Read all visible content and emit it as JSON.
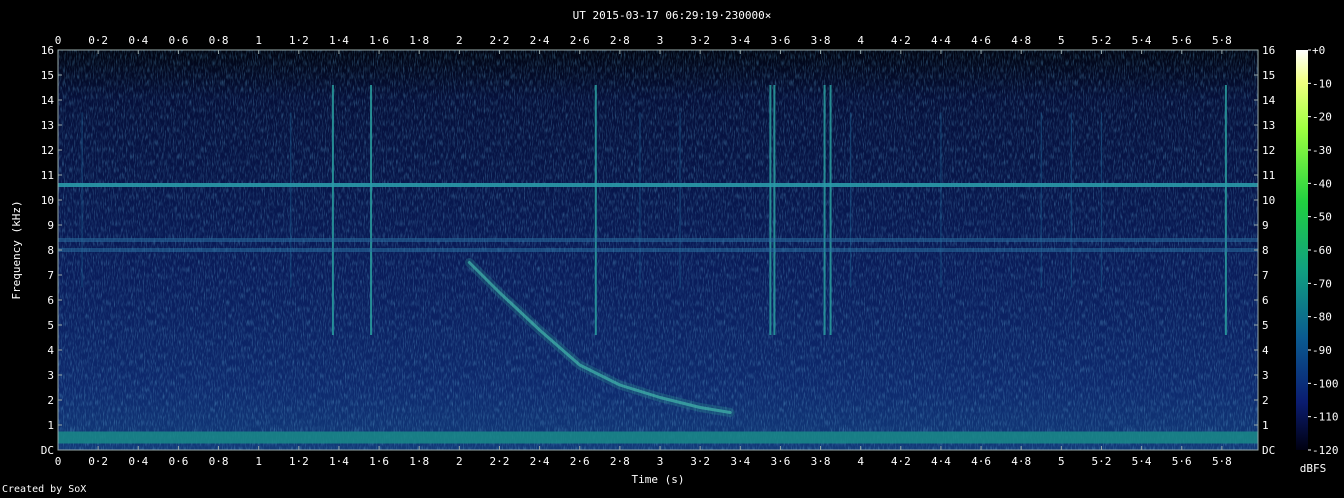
{
  "chart_data": {
    "type": "heatmap",
    "title": "UT 2015-03-17 06:29:19·230000×",
    "xlabel": "Time (s)",
    "ylabel": "Frequency (kHz)",
    "xlim": [
      0,
      5.98
    ],
    "ylim": [
      0,
      16
    ],
    "x_ticks": [
      "0",
      "0·2",
      "0·4",
      "0·6",
      "0·8",
      "1",
      "1·2",
      "1·4",
      "1·6",
      "1·8",
      "2",
      "2·2",
      "2·4",
      "2·6",
      "2·8",
      "3",
      "3·2",
      "3·4",
      "3·6",
      "3·8",
      "4",
      "4·2",
      "4·4",
      "4·6",
      "4·8",
      "5",
      "5·2",
      "5·4",
      "5·6",
      "5·8"
    ],
    "y_ticks": [
      "DC",
      "1",
      "2",
      "3",
      "4",
      "5",
      "6",
      "7",
      "8",
      "9",
      "10",
      "11",
      "12",
      "13",
      "14",
      "15",
      "16"
    ],
    "colorbar": {
      "label": "dBFS",
      "ticks": [
        "+0",
        "-10",
        "-20",
        "-30",
        "-40",
        "-50",
        "-60",
        "-70",
        "-80",
        "-90",
        "-100",
        "-110",
        "-120"
      ],
      "range": [
        -120,
        0
      ]
    },
    "features": {
      "tones_khz": [
        10.6,
        8.4,
        8.0,
        0.5
      ],
      "whistler": {
        "points": [
          [
            2.05,
            7.5
          ],
          [
            2.2,
            6.3
          ],
          [
            2.4,
            4.8
          ],
          [
            2.6,
            3.4
          ],
          [
            2.8,
            2.6
          ],
          [
            3.0,
            2.1
          ],
          [
            3.2,
            1.7
          ],
          [
            3.35,
            1.5
          ]
        ]
      },
      "impulses_s": [
        1.37,
        1.56,
        2.68,
        3.55,
        3.57,
        3.82,
        3.85,
        5.82,
        0.12,
        1.16,
        2.9,
        3.1,
        3.95,
        4.4,
        4.9,
        5.05,
        5.2
      ]
    },
    "credit": "Created by SoX"
  }
}
